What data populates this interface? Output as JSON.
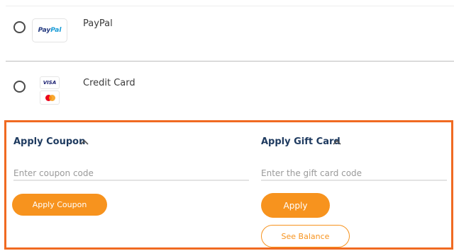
{
  "payment_methods": [
    {
      "label": "PayPal",
      "selected": false,
      "logo_text_a": "Pay",
      "logo_text_b": "Pal"
    },
    {
      "label": "Credit Card",
      "selected": false,
      "card_badges": [
        "VISA",
        "Mastercard"
      ]
    }
  ],
  "visa_text": "VISA",
  "coupon": {
    "title": "Apply Coupon",
    "placeholder": "Enter coupon code",
    "value": "",
    "button_label": "Apply Coupon",
    "expanded": true
  },
  "gift_card": {
    "title": "Apply Gift Card",
    "placeholder": "Enter the gift card code",
    "value": "",
    "apply_label": "Apply",
    "balance_label": "See Balance",
    "expanded": true
  },
  "icons": [
    "radio-unchecked-icon",
    "paypal-logo-icon",
    "visa-logo-icon",
    "mastercard-logo-icon",
    "chevron-up-icon"
  ],
  "colors": {
    "accent_orange": "#f7931e",
    "highlight_border": "#f06a21",
    "title_navy": "#1e3a5f"
  }
}
